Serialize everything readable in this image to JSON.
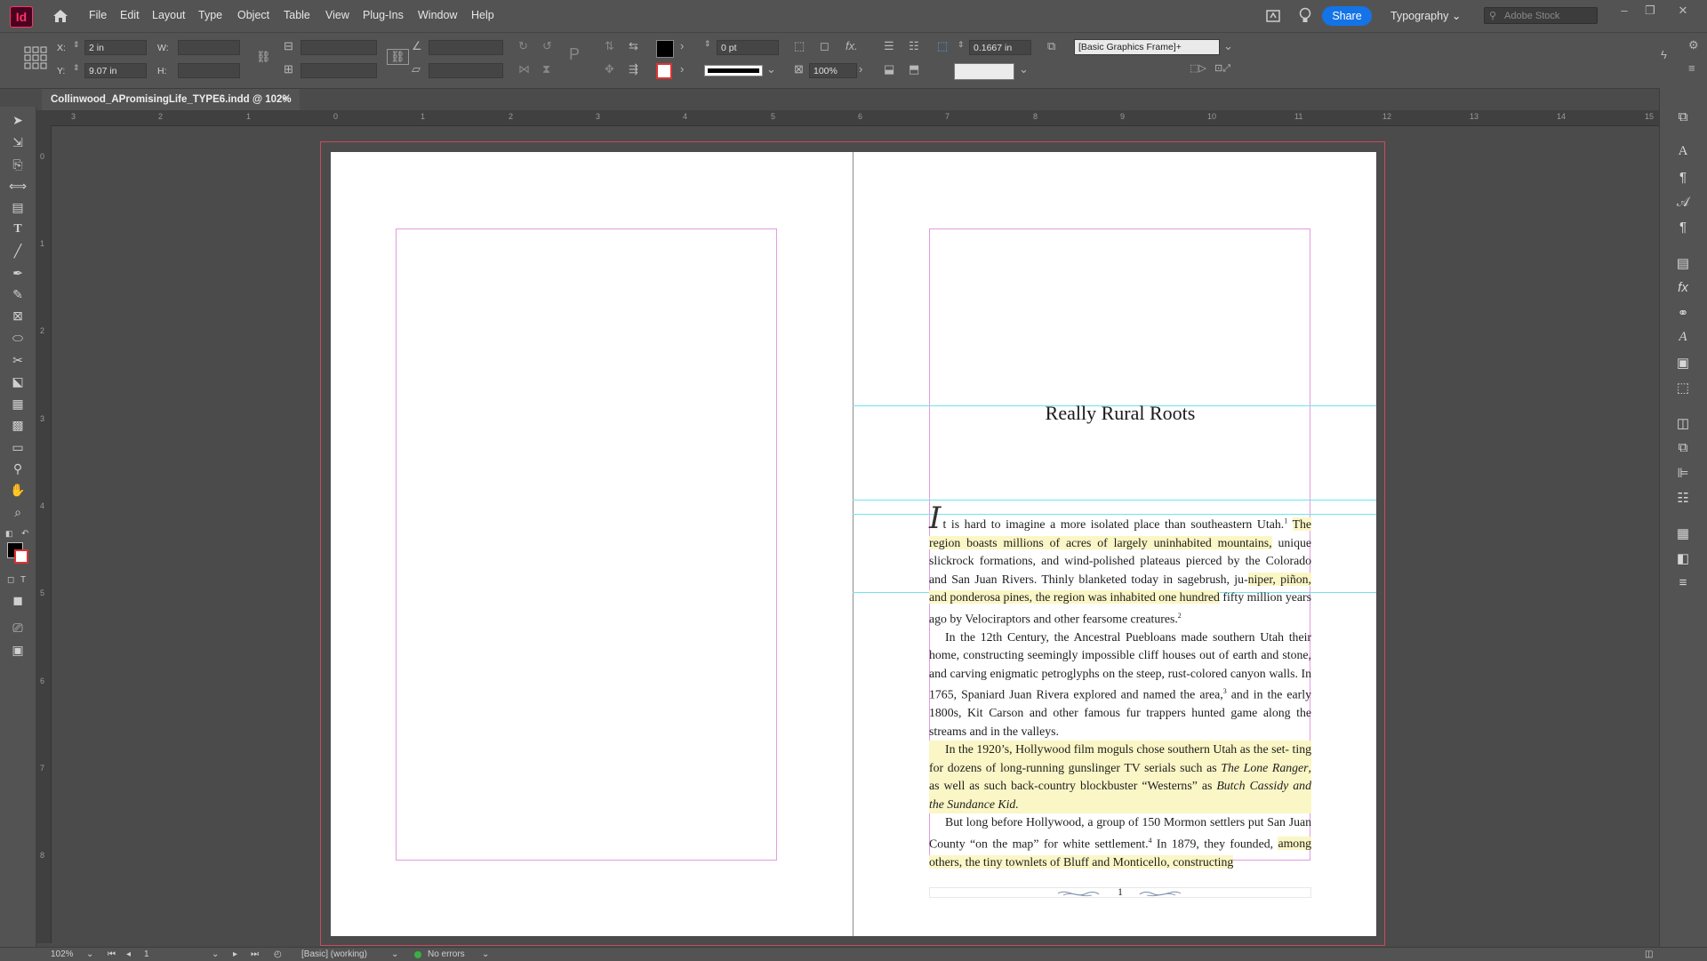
{
  "app": {
    "logo": "Id"
  },
  "menu": [
    "File",
    "Edit",
    "Layout",
    "Type",
    "Object",
    "Table",
    "View",
    "Plug-Ins",
    "Window",
    "Help"
  ],
  "header": {
    "share_label": "Share",
    "workspace_label": "Typography",
    "stock_placeholder": "Adobe Stock"
  },
  "control_panel": {
    "x_label": "X:",
    "x_value": "2 in",
    "y_label": "Y:",
    "y_value": "9.07 in",
    "w_label": "W:",
    "h_label": "H:",
    "stroke_weight": "0 pt",
    "opacity": "100%",
    "corner_value": "0.1667 in",
    "object_style": "[Basic Graphics Frame]+",
    "fill_color": "#000000"
  },
  "document": {
    "tab_title": "Collinwood_APromisingLife_TYPE6.indd @ 102%",
    "close_glyph": "×"
  },
  "ruler": {
    "labels": [
      "3",
      "2",
      "1",
      "0",
      "1",
      "2",
      "3",
      "4",
      "5",
      "6",
      "7",
      "8",
      "9",
      "10",
      "11",
      "12",
      "13",
      "14",
      "15"
    ]
  },
  "vruler": {
    "labels": [
      "0",
      "1",
      "2",
      "3",
      "4",
      "5",
      "6",
      "7",
      "8"
    ]
  },
  "page": {
    "chapter_title": "Really Rural Roots",
    "drop_cap": "I",
    "p1_a": "t is hard to imagine a more isolated place than southeastern Utah.",
    "fn1": "1",
    "p1_b": "The region boasts millions of acres of largely uninhabited mountains,",
    "p1_c": "unique slickrock formations, and wind-polished plateaus pierced by the Colorado and San Juan Rivers. Thinly blanketed today in sagebrush, ju-",
    "p1_d": "niper, piñon, and ponderosa pines, the region was inhabited one hundred",
    "p1_e": "fifty million years ago by Velociraptors and other fearsome creatures.",
    "fn2": "2",
    "p2_a": "In the 12th Century, the Ancestral Puebloans made southern Utah their home, constructing seemingly impossible cliff houses out of earth and stone, and carving enigmatic petroglyphs on the steep, rust-colored canyon walls. In 1765, Spaniard Juan Rivera explored and named the area,",
    "fn3": "3",
    "p2_b": " and in the early 1800s, Kit Carson and other famous fur trappers hunted game along the streams and in the valleys.",
    "p3_a": "In the 1920’s, Hollywood film moguls chose southern Utah as the set-",
    "p3_b": "ting for dozens of long-running gunslinger TV serials such as ",
    "p3_i1": "The Lone Ranger",
    "p3_c": ", as well as such back-country blockbuster “Westerns” as ",
    "p3_i2": "Butch Cassidy and the Sundance Kid.",
    "p4_a": "But long before Hollywood, a group of 150 Mormon settlers put San Juan County “on the map” for white settlement.",
    "fn4": "4",
    "p4_b": " In 1879, they founded,",
    "p4_c": "among others, the tiny townlets of Bluff and Monticello, constructing",
    "folio": "1"
  },
  "status": {
    "zoom": "102%",
    "page_num": "1",
    "preflight_profile": "[Basic] (working)",
    "errors": "No errors"
  },
  "colors": {
    "accent": "#1473e6",
    "logo": "#ff3366",
    "highlight": "#fbf6c6",
    "margin_guide": "#e39be0",
    "ruler_guide": "#6fe3ef",
    "bleed": "#c84b5f"
  }
}
